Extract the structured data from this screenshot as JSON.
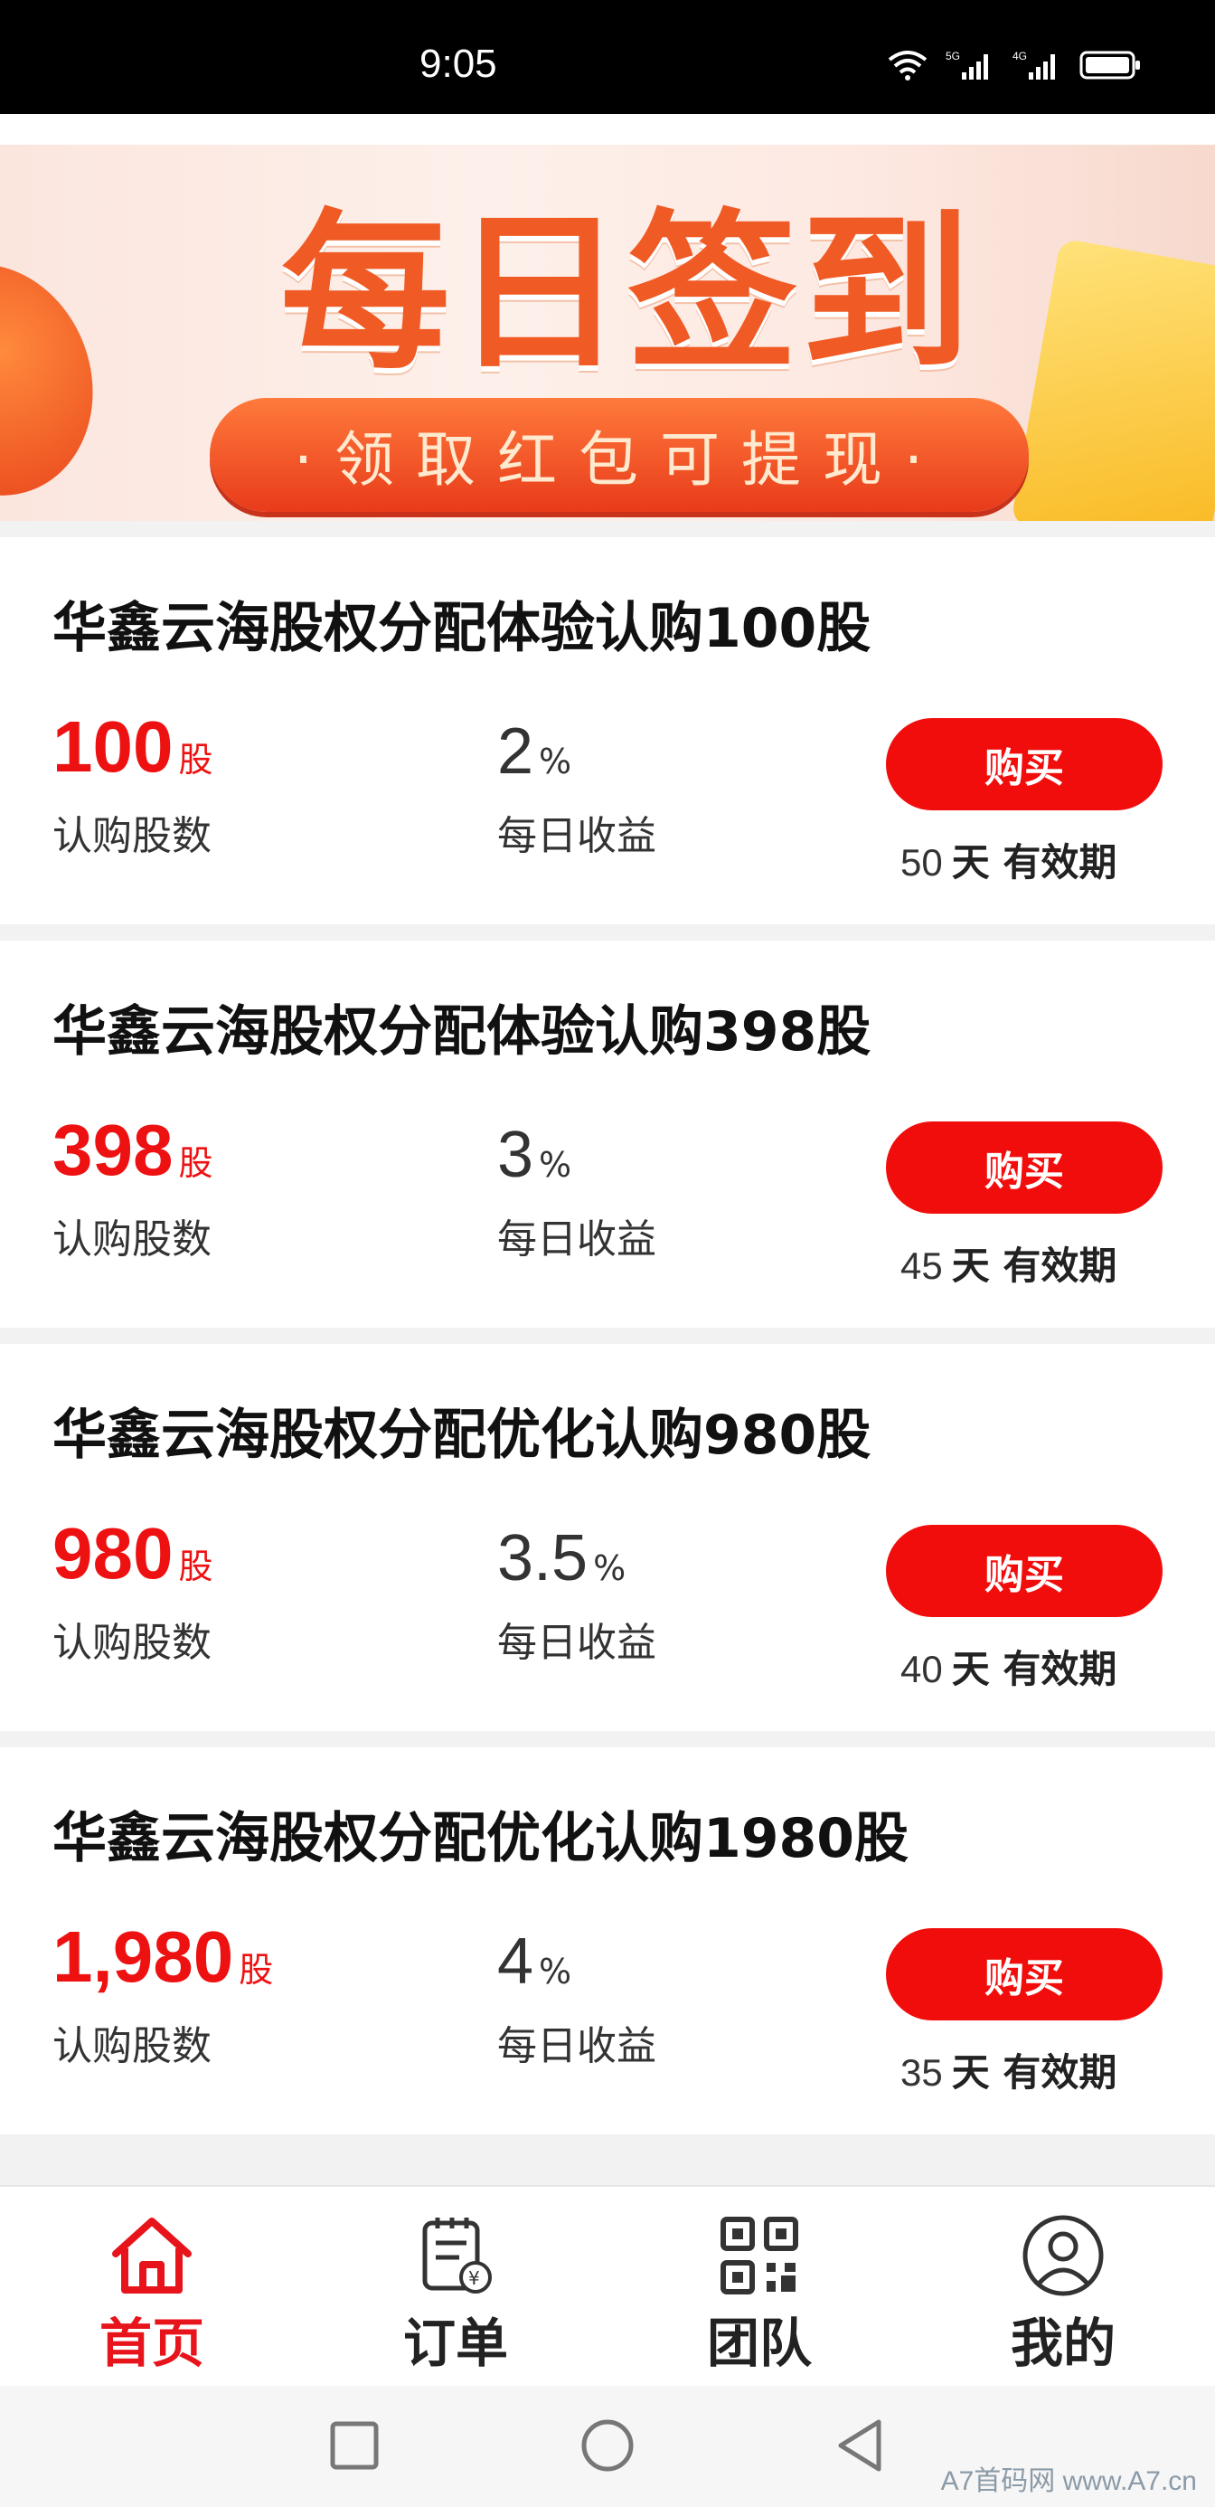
{
  "status_bar": {
    "time": "9:05"
  },
  "banner": {
    "title": "每日签到",
    "subtitle": "·领取红包可提现·"
  },
  "products": [
    {
      "title": "华鑫云海股权分配体验认购100股",
      "quantity": "100",
      "quantity_unit": "股",
      "quantity_label": "认购股数",
      "rate": "2",
      "rate_unit": "%",
      "rate_label": "每日收益",
      "button": "购买",
      "days": "50",
      "validity_text": "天 有效期"
    },
    {
      "title": "华鑫云海股权分配体验认购398股",
      "quantity": "398",
      "quantity_unit": "股",
      "quantity_label": "认购股数",
      "rate": "3",
      "rate_unit": "%",
      "rate_label": "每日收益",
      "button": "购买",
      "days": "45",
      "validity_text": "天 有效期"
    },
    {
      "title": "华鑫云海股权分配优化认购980股",
      "quantity": "980",
      "quantity_unit": "股",
      "quantity_label": "认购股数",
      "rate": "3.5",
      "rate_unit": "%",
      "rate_label": "每日收益",
      "button": "购买",
      "days": "40",
      "validity_text": "天 有效期"
    },
    {
      "title": "华鑫云海股权分配优化认购1980股",
      "quantity": "1,980",
      "quantity_unit": "股",
      "quantity_label": "认购股数",
      "rate": "4",
      "rate_unit": "%",
      "rate_label": "每日收益",
      "button": "购买",
      "days": "35",
      "validity_text": "天 有效期"
    }
  ],
  "tabbar": {
    "items": [
      {
        "label": "首页",
        "icon": "home-icon",
        "active": true
      },
      {
        "label": "订单",
        "icon": "order-icon",
        "active": false
      },
      {
        "label": "团队",
        "icon": "qr-code-icon",
        "active": false
      },
      {
        "label": "我的",
        "icon": "user-icon",
        "active": false
      }
    ]
  },
  "watermark": "A7首码网 www.A7.cn",
  "colors": {
    "accent": "#f20d0d",
    "active_tab": "#e8141c",
    "banner_orange": "#f05a24"
  }
}
